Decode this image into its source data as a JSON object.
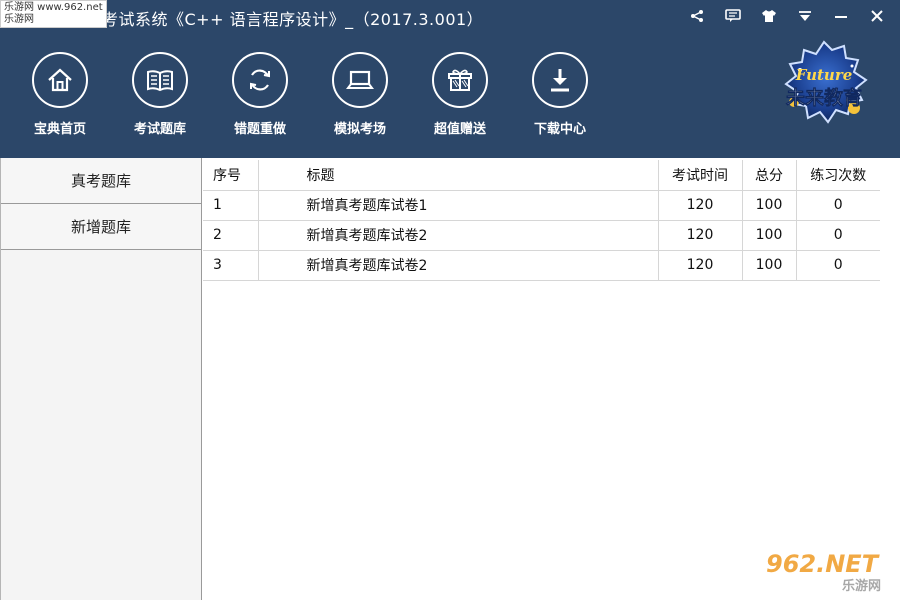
{
  "window": {
    "title": "未来教育考试系统《C++ 语言程序设计》_（2017.3.001）",
    "controls": [
      {
        "name": "share-icon"
      },
      {
        "name": "message-icon"
      },
      {
        "name": "skin-icon"
      },
      {
        "name": "dropdown-icon"
      },
      {
        "name": "minimize-icon"
      },
      {
        "name": "close-icon"
      }
    ]
  },
  "watermark_top": {
    "line1": "乐游网 www.962.net",
    "line2": "乐游网"
  },
  "toolbar": {
    "items": [
      {
        "label": "宝典首页",
        "icon": "home-icon"
      },
      {
        "label": "考试题库",
        "icon": "book-icon"
      },
      {
        "label": "错题重做",
        "icon": "refresh-icon"
      },
      {
        "label": "模拟考场",
        "icon": "laptop-icon"
      },
      {
        "label": "超值赠送",
        "icon": "gift-icon"
      },
      {
        "label": "下载中心",
        "icon": "download-icon"
      }
    ]
  },
  "logo": {
    "text_top": "Future",
    "text_main": "未来教育"
  },
  "sidebar": {
    "items": [
      {
        "label": "真考题库"
      },
      {
        "label": "新增题库"
      }
    ]
  },
  "table": {
    "headers": {
      "idx": "序号",
      "title": "标题",
      "time": "考试时间",
      "score": "总分",
      "count": "练习次数"
    },
    "rows": [
      {
        "idx": "1",
        "title": "新增真考题库试卷1",
        "time": "120",
        "score": "100",
        "count": "0"
      },
      {
        "idx": "2",
        "title": "新增真考题库试卷2",
        "time": "120",
        "score": "100",
        "count": "0"
      },
      {
        "idx": "3",
        "title": "新增真考题库试卷2",
        "time": "120",
        "score": "100",
        "count": "0"
      }
    ]
  },
  "watermark_bottom": {
    "brand": "962.NET",
    "site": "乐游网"
  },
  "colors": {
    "header_bg": "#2c4769",
    "panel_bg": "#f4f4f4",
    "text": "#111111"
  }
}
